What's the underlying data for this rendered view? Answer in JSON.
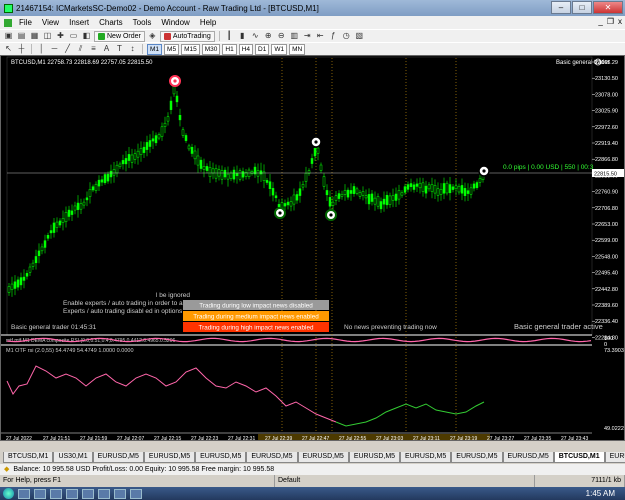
{
  "window": {
    "title": "21467154: ICMarketsSC-Demo02 - Demo Account - Raw Trading Ltd - [BTCUSD,M1]",
    "buttons": {
      "minimize": "–",
      "maximize": "□",
      "close": "✕"
    }
  },
  "menu": {
    "items": [
      "File",
      "View",
      "Insert",
      "Charts",
      "Tools",
      "Window",
      "Help"
    ],
    "mdi": {
      "minimize": "_",
      "restore": "❐",
      "close": "x"
    }
  },
  "toolbar": {
    "new_order": "New Order",
    "autotrading": "AutoTrading",
    "timeframes": [
      "M1",
      "M5",
      "M15",
      "M30",
      "H1",
      "H4",
      "D1",
      "W1",
      "MN"
    ],
    "active_timeframe": "M1"
  },
  "chart": {
    "header": "BTCUSD,M1  22758.73 22818.69 22757.05 22815.50",
    "ea_name": "Basic general trader",
    "price_axis": [
      "23165.29",
      "23130.50",
      "23078.00",
      "23025.90",
      "22972.60",
      "22919.40",
      "22866.80",
      "22813.60",
      "22760.90",
      "22706.80",
      "22653.00",
      "22599.00",
      "22548.00",
      "22495.40",
      "22442.80",
      "22389.60",
      "22336.40",
      "22284.80"
    ],
    "current_label": "22815.50",
    "pips_label": "0.0 pips | 0.00 USD | 550 | 00:3",
    "info_lines": [
      "l be ignored",
      "Enable experts / auto trading in order to allow",
      "Experts / auto trading disabl ed in options"
    ],
    "news": {
      "low": "Trading during low impact news disabled",
      "medium": "Trading during medium impact news enabled",
      "high": "Trading during high impact news enabled",
      "none": "No news preventing trading now"
    },
    "ea_status": "Basic general trader active",
    "timer": "Basic general trader 01:45:31",
    "indicator1": {
      "header": "mtf mtf M1 DEMA composite RSI (0.0,0.51,0.4,0.4795.0.4412.0.4965.0.5206",
      "axis_top": "100",
      "axis_bottom": "0"
    },
    "indicator2": {
      "header": "M1 OTF rsi (2.0,55) 54.4749 54.4749 1.0000 0.0000",
      "axis_top": "73.3903",
      "axis_bottom": "49.0222"
    },
    "time_axis": [
      "27 Jul 2022",
      "27 Jul 21:51",
      "27 Jul 21:59",
      "27 Jul 22:07",
      "27 Jul 22:15",
      "27 Jul 22:23",
      "27 Jul 22:31",
      "27 Jul 22:39",
      "27 Jul 22:47",
      "27 Jul 22:55",
      "27 Jul 23:03",
      "27 Jul 23:11",
      "27 Jul 23:19",
      "27 Jul 23:27",
      "27 Jul 23:35",
      "27 Jul 23:43"
    ],
    "colors": {
      "bull": "#00ff00",
      "bear": "#00ff00",
      "dema_up": "#ff66aa",
      "dema_dn": "#33cc33",
      "low_news": "#9a9a9a",
      "medium_news": "#ff9900",
      "high_news": "#ff3300"
    }
  },
  "tabs": [
    "BTCUSD,M1",
    "US30,M1",
    "EURUSD,M5",
    "EURUSD,M5",
    "EURUSD,M5",
    "EURUSD,M5",
    "EURUSD,M5",
    "EURUSD,M5",
    "EURUSD,M5",
    "EURUSD,M5",
    "EURUSD,M5",
    "BTCUSD,M1",
    "EURUSD,M1"
  ],
  "active_tab_index": 11,
  "balance": {
    "text": "Balance: 10 995.58 USD  Profit/Loss: 0.00  Equity: 10 995.58  Free margin: 10 995.58"
  },
  "status": {
    "help": "For Help, press F1",
    "profile": "Default",
    "connection": "7111/1 kb"
  },
  "taskbar": {
    "clock": "1:45 AM"
  }
}
